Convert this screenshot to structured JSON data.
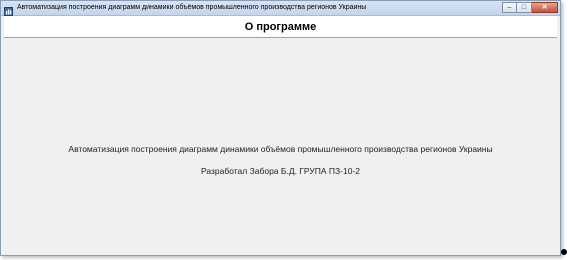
{
  "window": {
    "title": "Автоматизация построения диаграмм динамики объёмов промышленного производства регионов Украины",
    "controls": {
      "minimize_icon": "minimize-icon",
      "maximize_icon": "maximize-icon",
      "close_icon": "close-icon",
      "minimize_glyph": "–",
      "maximize_glyph": "□",
      "close_glyph": "✕"
    }
  },
  "header": {
    "title": "О программе"
  },
  "content": {
    "description": "Автоматизация построения диаграмм динамики объёмов промышленного производства регионов Украины",
    "author": "Разработал Забора Б.Д. ГРУПА ПЗ-10-2"
  },
  "colors": {
    "titlebar": "#c3d6ec",
    "close_button": "#c7513a",
    "window_background": "#f0f0f0",
    "header_background": "#ffffff"
  }
}
